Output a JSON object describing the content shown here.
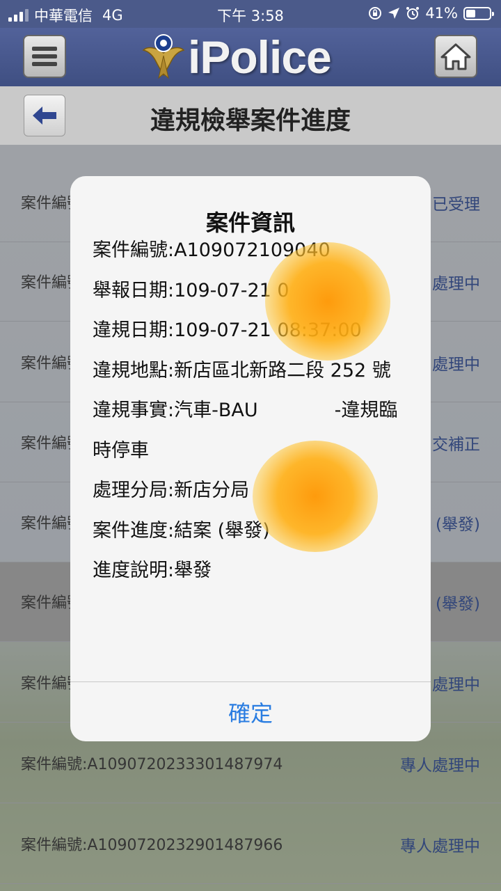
{
  "status_bar": {
    "carrier": "中華電信",
    "network": "4G",
    "time": "下午 3:58",
    "battery": "41%",
    "battery_level": 0.41
  },
  "header": {
    "brand": "iPolice"
  },
  "title_bar": {
    "title": "違規檢舉案件進度"
  },
  "list": [
    {
      "case_id": "案件編號",
      "status": "已受理"
    },
    {
      "case_id": "案件編號",
      "status": "處理中"
    },
    {
      "case_id": "案件編號",
      "status": "處理中"
    },
    {
      "case_id": "案件編號",
      "status": "交補正"
    },
    {
      "case_id": "案件編號",
      "status": "(舉發)"
    },
    {
      "case_id": "案件編號",
      "status": "(舉發)"
    },
    {
      "case_id": "案件編號",
      "status": "處理中"
    },
    {
      "case_id": "案件編號:A1090720233301487974",
      "status": "專人處理中"
    },
    {
      "case_id": "案件編號:A1090720232901487966",
      "status": "專人處理中"
    }
  ],
  "dialog": {
    "title": "案件資訊",
    "lines": [
      "案件編號:A109072109040",
      "舉報日期:109-07-21 0",
      "違規日期:109-07-21 08:37:00",
      "違規地點:新店區北新路二段 252 號",
      "違規事實:汽車-BAU",
      "-違規臨時停車",
      "處理分局:新店分局",
      "案件進度:結案 (舉發)",
      "進度說明:舉發"
    ],
    "confirm": "確定"
  }
}
